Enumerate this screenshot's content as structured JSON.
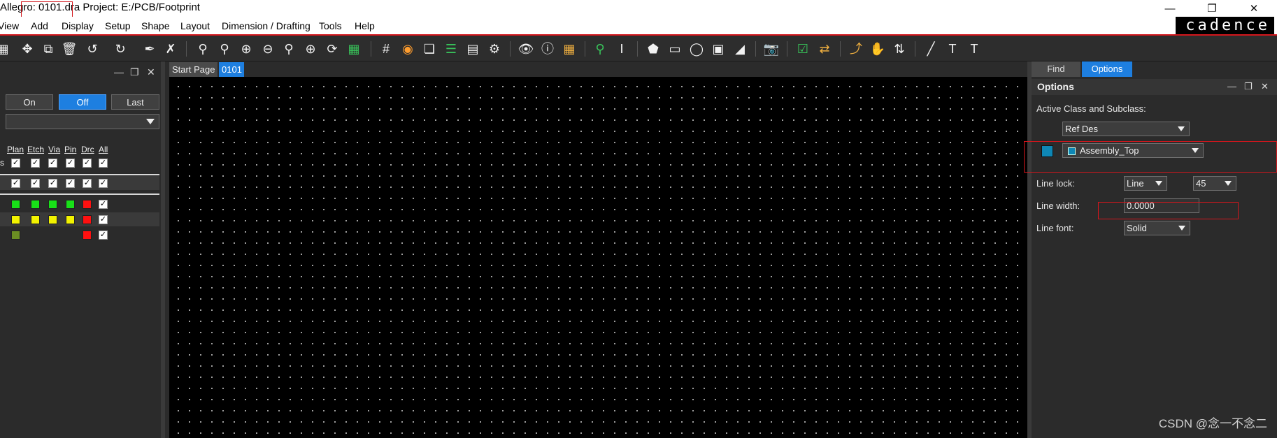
{
  "window": {
    "title": "Allegro: 0101.dra  Project: E:/PCB/Footprint",
    "controls": [
      "minimize-icon",
      "restore-icon",
      "close-icon"
    ]
  },
  "menu": {
    "items": [
      {
        "label": "View"
      },
      {
        "label": "Add"
      },
      {
        "label": "Display"
      },
      {
        "label": "Setup"
      },
      {
        "label": "Shape"
      },
      {
        "label": "Layout"
      },
      {
        "label": "Dimension / Drafting"
      },
      {
        "label": "Tools"
      },
      {
        "label": "Help"
      }
    ],
    "brand": "cadence"
  },
  "visibility": {
    "buttons": {
      "on": "On",
      "off": "Off",
      "last": "Last"
    },
    "selected_button": "Off",
    "columns": [
      "Plan",
      "Etch",
      "Via",
      "Pin",
      "Drc",
      "All"
    ],
    "row_prefix": "s",
    "check_mark": "✓",
    "swatch_colors": {
      "green": "#18e018",
      "yellow": "#f2f200",
      "red": "#ff1010",
      "olive": "#6b8e23"
    }
  },
  "canvas": {
    "tabs": [
      "Start Page",
      "0101"
    ],
    "active_tab": "0101",
    "background": "#000000"
  },
  "options_panel": {
    "tabs": [
      "Find",
      "Options"
    ],
    "active_tab": "Options",
    "title": "Options",
    "active_class_label": "Active Class and Subclass:",
    "class_value": "Ref Des",
    "subclass_value": "Assembly_Top",
    "subclass_color": "#0e87b5",
    "line_lock_label": "Line lock:",
    "line_lock_mode": "Line",
    "line_lock_angle": "45",
    "line_width_label": "Line width:",
    "line_width_value": "0.0000",
    "line_font_label": "Line font:",
    "line_font_value": "Solid"
  },
  "watermark": "CSDN @念一不念二",
  "colors": {
    "accent": "#1e7fe0",
    "highlight": "#d4161c"
  }
}
